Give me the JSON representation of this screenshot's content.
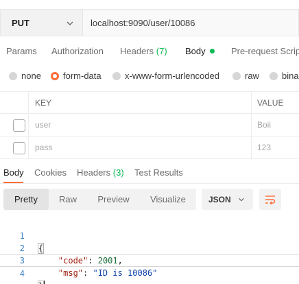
{
  "request": {
    "method": "PUT",
    "url": "localhost:9090/user/10086"
  },
  "request_tabs": {
    "params": "Params",
    "authorization": "Authorization",
    "headers_label": "Headers",
    "headers_count": "(7)",
    "body": "Body",
    "prerequest": "Pre-request Scrip"
  },
  "body_types": {
    "none": "none",
    "form_data": "form-data",
    "urlencoded": "x-www-form-urlencoded",
    "raw": "raw",
    "binary": "binar",
    "selected": "form-data"
  },
  "form_table": {
    "headers": {
      "key": "KEY",
      "value": "VALUE"
    },
    "rows": [
      {
        "key": "user",
        "value": "Boii"
      },
      {
        "key": "pass",
        "value": "123"
      }
    ]
  },
  "response_tabs": {
    "body": "Body",
    "cookies": "Cookies",
    "headers_label": "Headers",
    "headers_count": "(3)",
    "test_results": "Test Results"
  },
  "view_modes": {
    "pretty": "Pretty",
    "raw": "Raw",
    "preview": "Preview",
    "visualize": "Visualize",
    "active": "Pretty"
  },
  "format": {
    "selected": "JSON"
  },
  "response_body": {
    "line_numbers": [
      "1",
      "2",
      "3",
      "4"
    ],
    "open_brace": "{",
    "code_key": "\"code\"",
    "code_value": "2001",
    "msg_key": "\"msg\"",
    "msg_value": "\"ID is 10086\"",
    "close_brace": "}"
  },
  "colors": {
    "accent": "#ff6c37",
    "green": "#0cbb52",
    "line_number": "#3b82c4"
  },
  "icons": {
    "method_dropdown": "chevron-down-icon",
    "format_dropdown": "chevron-down-icon",
    "wrap": "wrap-lines-icon"
  }
}
